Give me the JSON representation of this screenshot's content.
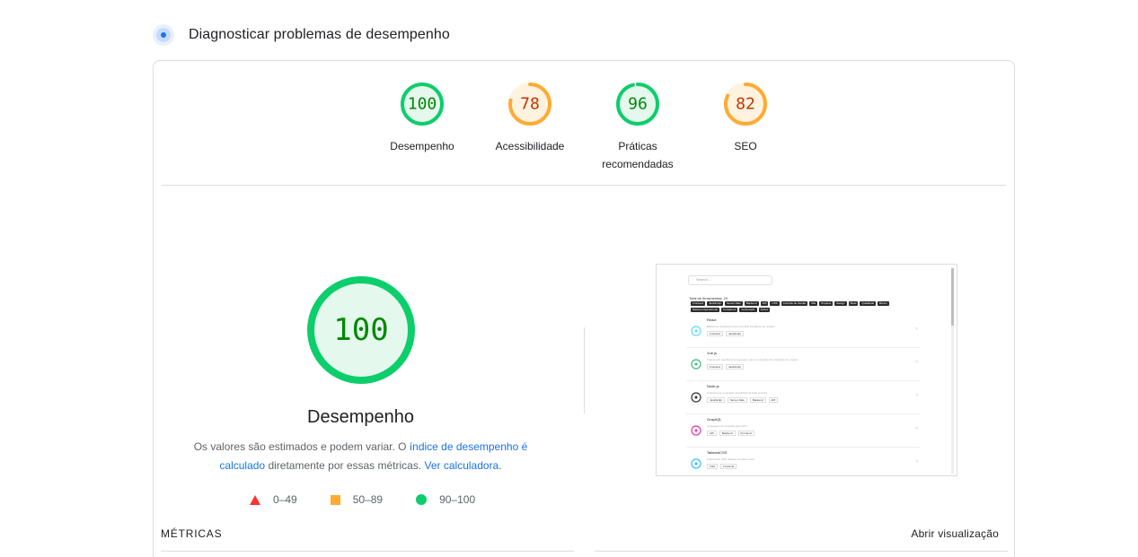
{
  "header": {
    "title": "Diagnosticar problemas de desempenho",
    "icon": "diagnostics-icon"
  },
  "gauges": [
    {
      "score": "100",
      "label": "Desempenho",
      "status": "pass",
      "color": "#0cce6b",
      "text_color": "#008800",
      "fill": "#e5f8ee",
      "fraction": 1.0
    },
    {
      "score": "78",
      "label": "Acessibilidade",
      "status": "average",
      "color": "#ffaa33",
      "text_color": "#c33300",
      "fill": "#fff3e0",
      "fraction": 0.78
    },
    {
      "score": "96",
      "label": "Práticas recomendadas",
      "status": "pass",
      "color": "#0cce6b",
      "text_color": "#008800",
      "fill": "#e5f8ee",
      "fraction": 0.96
    },
    {
      "score": "82",
      "label": "SEO",
      "status": "average",
      "color": "#ffaa33",
      "text_color": "#c33300",
      "fill": "#fff3e0",
      "fraction": 0.82
    }
  ],
  "main": {
    "score": "100",
    "fraction": 1.0,
    "title": "Desempenho",
    "desc_prefix": "Os valores são estimados e podem variar. O ",
    "desc_link": "índice de desempenho é calculado",
    "desc_middle": " diretamente por essas métricas. ",
    "desc_calc_link": "Ver calculadora",
    "desc_suffix": "."
  },
  "legend": [
    {
      "range": "0–49",
      "shape": "triangle",
      "color": "#ff3333"
    },
    {
      "range": "50–89",
      "shape": "square",
      "color": "#ffaa33"
    },
    {
      "range": "90–100",
      "shape": "circle",
      "color": "#0cce6b"
    }
  ],
  "metrics_label": "MÉTRICAS",
  "open_view_label": "Abrir visualização",
  "screenshot": {
    "search_placeholder": "Search...",
    "total_text": "Total de ferramentas: 20",
    "chips": [
      "Frontend",
      "JavaScript",
      "Server-Side",
      "Backend",
      "API",
      "CSS",
      "Controle de Versão",
      "IDE",
      "Projetos",
      "Design",
      "Boas",
      "Qualidade",
      "Banco",
      "Sistema Operacional",
      "Containers",
      "Automação",
      "Testes"
    ],
    "items": [
      {
        "title": "React",
        "desc": "Biblioteca JavaScript para construir interfaces de usuário",
        "tags": [
          "Frontend",
          "JavaScript"
        ],
        "logo_color": "#61dafb",
        "logo": "react-logo-icon"
      },
      {
        "title": "Vue.js",
        "desc": "Framework JavaScript progressivo para construção de interfaces de usuário",
        "tags": [
          "Frontend",
          "JavaScript"
        ],
        "logo_color": "#41b883",
        "logo": "vue-logo-icon"
      },
      {
        "title": "Node.js",
        "desc": "Ambiente de execução JavaScript do lado servidor",
        "tags": [
          "JavaScript",
          "Server-Side",
          "Backend",
          "API"
        ],
        "logo_color": "#333333",
        "logo": "node-logo-icon"
      },
      {
        "title": "GraphQL",
        "desc": "Linguagem de consulta para APIs",
        "tags": [
          "API",
          "Backend",
          "Frontend"
        ],
        "logo_color": "#e535ab",
        "logo": "graphql-logo-icon"
      },
      {
        "title": "TailwindCSS",
        "desc": "Framework CSS utilitário de baixo nível",
        "tags": [
          "CSS",
          "Frontend"
        ],
        "logo_color": "#38bdf8",
        "logo": "tailwind-logo-icon"
      }
    ]
  }
}
